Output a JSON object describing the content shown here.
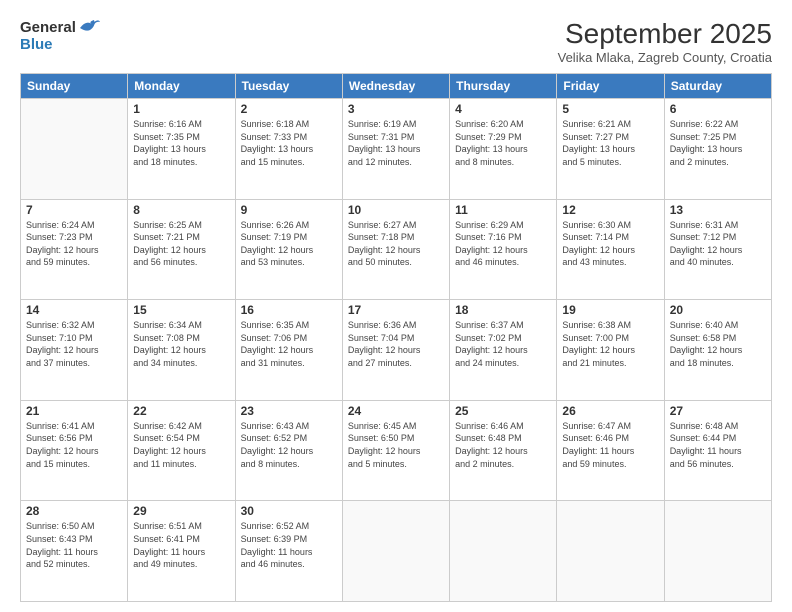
{
  "logo": {
    "general": "General",
    "blue": "Blue"
  },
  "title": "September 2025",
  "subtitle": "Velika Mlaka, Zagreb County, Croatia",
  "weekdays": [
    "Sunday",
    "Monday",
    "Tuesday",
    "Wednesday",
    "Thursday",
    "Friday",
    "Saturday"
  ],
  "weeks": [
    [
      {
        "day": "",
        "info": ""
      },
      {
        "day": "1",
        "info": "Sunrise: 6:16 AM\nSunset: 7:35 PM\nDaylight: 13 hours\nand 18 minutes."
      },
      {
        "day": "2",
        "info": "Sunrise: 6:18 AM\nSunset: 7:33 PM\nDaylight: 13 hours\nand 15 minutes."
      },
      {
        "day": "3",
        "info": "Sunrise: 6:19 AM\nSunset: 7:31 PM\nDaylight: 13 hours\nand 12 minutes."
      },
      {
        "day": "4",
        "info": "Sunrise: 6:20 AM\nSunset: 7:29 PM\nDaylight: 13 hours\nand 8 minutes."
      },
      {
        "day": "5",
        "info": "Sunrise: 6:21 AM\nSunset: 7:27 PM\nDaylight: 13 hours\nand 5 minutes."
      },
      {
        "day": "6",
        "info": "Sunrise: 6:22 AM\nSunset: 7:25 PM\nDaylight: 13 hours\nand 2 minutes."
      }
    ],
    [
      {
        "day": "7",
        "info": "Sunrise: 6:24 AM\nSunset: 7:23 PM\nDaylight: 12 hours\nand 59 minutes."
      },
      {
        "day": "8",
        "info": "Sunrise: 6:25 AM\nSunset: 7:21 PM\nDaylight: 12 hours\nand 56 minutes."
      },
      {
        "day": "9",
        "info": "Sunrise: 6:26 AM\nSunset: 7:19 PM\nDaylight: 12 hours\nand 53 minutes."
      },
      {
        "day": "10",
        "info": "Sunrise: 6:27 AM\nSunset: 7:18 PM\nDaylight: 12 hours\nand 50 minutes."
      },
      {
        "day": "11",
        "info": "Sunrise: 6:29 AM\nSunset: 7:16 PM\nDaylight: 12 hours\nand 46 minutes."
      },
      {
        "day": "12",
        "info": "Sunrise: 6:30 AM\nSunset: 7:14 PM\nDaylight: 12 hours\nand 43 minutes."
      },
      {
        "day": "13",
        "info": "Sunrise: 6:31 AM\nSunset: 7:12 PM\nDaylight: 12 hours\nand 40 minutes."
      }
    ],
    [
      {
        "day": "14",
        "info": "Sunrise: 6:32 AM\nSunset: 7:10 PM\nDaylight: 12 hours\nand 37 minutes."
      },
      {
        "day": "15",
        "info": "Sunrise: 6:34 AM\nSunset: 7:08 PM\nDaylight: 12 hours\nand 34 minutes."
      },
      {
        "day": "16",
        "info": "Sunrise: 6:35 AM\nSunset: 7:06 PM\nDaylight: 12 hours\nand 31 minutes."
      },
      {
        "day": "17",
        "info": "Sunrise: 6:36 AM\nSunset: 7:04 PM\nDaylight: 12 hours\nand 27 minutes."
      },
      {
        "day": "18",
        "info": "Sunrise: 6:37 AM\nSunset: 7:02 PM\nDaylight: 12 hours\nand 24 minutes."
      },
      {
        "day": "19",
        "info": "Sunrise: 6:38 AM\nSunset: 7:00 PM\nDaylight: 12 hours\nand 21 minutes."
      },
      {
        "day": "20",
        "info": "Sunrise: 6:40 AM\nSunset: 6:58 PM\nDaylight: 12 hours\nand 18 minutes."
      }
    ],
    [
      {
        "day": "21",
        "info": "Sunrise: 6:41 AM\nSunset: 6:56 PM\nDaylight: 12 hours\nand 15 minutes."
      },
      {
        "day": "22",
        "info": "Sunrise: 6:42 AM\nSunset: 6:54 PM\nDaylight: 12 hours\nand 11 minutes."
      },
      {
        "day": "23",
        "info": "Sunrise: 6:43 AM\nSunset: 6:52 PM\nDaylight: 12 hours\nand 8 minutes."
      },
      {
        "day": "24",
        "info": "Sunrise: 6:45 AM\nSunset: 6:50 PM\nDaylight: 12 hours\nand 5 minutes."
      },
      {
        "day": "25",
        "info": "Sunrise: 6:46 AM\nSunset: 6:48 PM\nDaylight: 12 hours\nand 2 minutes."
      },
      {
        "day": "26",
        "info": "Sunrise: 6:47 AM\nSunset: 6:46 PM\nDaylight: 11 hours\nand 59 minutes."
      },
      {
        "day": "27",
        "info": "Sunrise: 6:48 AM\nSunset: 6:44 PM\nDaylight: 11 hours\nand 56 minutes."
      }
    ],
    [
      {
        "day": "28",
        "info": "Sunrise: 6:50 AM\nSunset: 6:43 PM\nDaylight: 11 hours\nand 52 minutes."
      },
      {
        "day": "29",
        "info": "Sunrise: 6:51 AM\nSunset: 6:41 PM\nDaylight: 11 hours\nand 49 minutes."
      },
      {
        "day": "30",
        "info": "Sunrise: 6:52 AM\nSunset: 6:39 PM\nDaylight: 11 hours\nand 46 minutes."
      },
      {
        "day": "",
        "info": ""
      },
      {
        "day": "",
        "info": ""
      },
      {
        "day": "",
        "info": ""
      },
      {
        "day": "",
        "info": ""
      }
    ]
  ]
}
